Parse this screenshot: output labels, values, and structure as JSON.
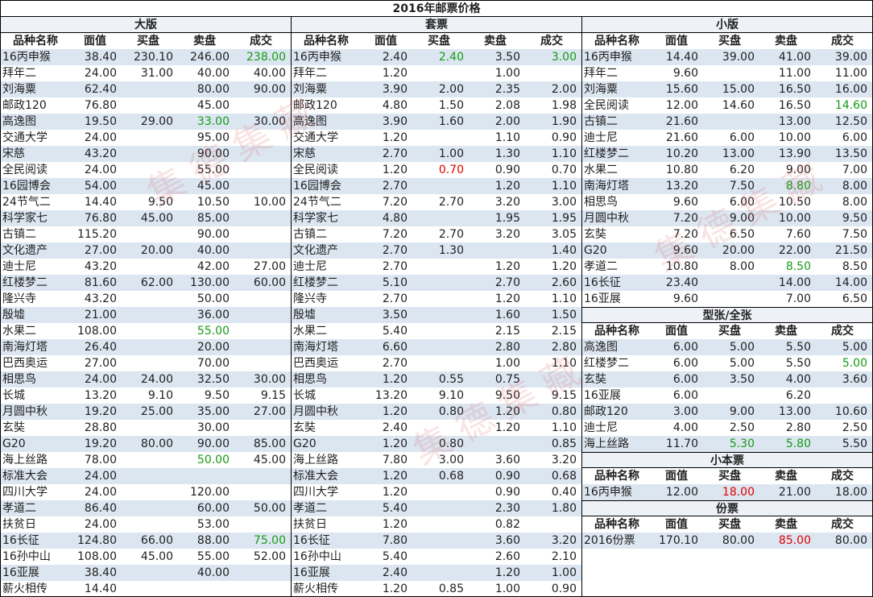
{
  "title": "2016年邮票价格",
  "headers": [
    "品种名称",
    "面值",
    "买盘",
    "卖盘",
    "成交"
  ],
  "watermark": "集德集藏",
  "large": {
    "heading": "大版",
    "rows": [
      {
        "name": "16丙申猴",
        "face": "38.40",
        "buy": "230.10",
        "sell": "246.00",
        "deal": "238.00",
        "dealColor": "green"
      },
      {
        "name": "拜年二",
        "face": "24.00",
        "buy": "31.00",
        "sell": "40.00",
        "deal": "40.00"
      },
      {
        "name": "刘海粟",
        "face": "62.40",
        "buy": "",
        "sell": "80.00",
        "deal": "90.00"
      },
      {
        "name": "邮政120",
        "face": "76.80",
        "buy": "",
        "sell": "45.00",
        "deal": ""
      },
      {
        "name": "高逸图",
        "face": "19.50",
        "buy": "29.00",
        "sell": "33.00",
        "deal": "30.00",
        "sellColor": "green"
      },
      {
        "name": "交通大学",
        "face": "24.00",
        "buy": "",
        "sell": "95.00",
        "deal": ""
      },
      {
        "name": "宋慈",
        "face": "43.20",
        "buy": "",
        "sell": "90.00",
        "deal": ""
      },
      {
        "name": "全民阅读",
        "face": "24.00",
        "buy": "",
        "sell": "55.00",
        "deal": ""
      },
      {
        "name": "16园博会",
        "face": "54.00",
        "buy": "",
        "sell": "45.00",
        "deal": ""
      },
      {
        "name": "24节气二",
        "face": "14.40",
        "buy": "9.50",
        "sell": "10.50",
        "deal": "10.00"
      },
      {
        "name": "科学家七",
        "face": "76.80",
        "buy": "45.00",
        "sell": "85.00",
        "deal": ""
      },
      {
        "name": "古镇二",
        "face": "115.20",
        "buy": "",
        "sell": "90.00",
        "deal": ""
      },
      {
        "name": "文化遗产",
        "face": "27.00",
        "buy": "20.00",
        "sell": "40.00",
        "deal": ""
      },
      {
        "name": "迪士尼",
        "face": "43.20",
        "buy": "",
        "sell": "42.00",
        "deal": "27.00"
      },
      {
        "name": "红楼梦二",
        "face": "81.60",
        "buy": "62.00",
        "sell": "130.00",
        "deal": "60.00"
      },
      {
        "name": "隆兴寺",
        "face": "43.20",
        "buy": "",
        "sell": "50.00",
        "deal": ""
      },
      {
        "name": "殷墟",
        "face": "21.00",
        "buy": "",
        "sell": "36.00",
        "deal": ""
      },
      {
        "name": "水果二",
        "face": "108.00",
        "buy": "",
        "sell": "55.00",
        "deal": "",
        "sellColor": "green"
      },
      {
        "name": "南海灯塔",
        "face": "26.40",
        "buy": "",
        "sell": "20.00",
        "deal": ""
      },
      {
        "name": "巴西奥运",
        "face": "27.00",
        "buy": "",
        "sell": "70.00",
        "deal": ""
      },
      {
        "name": "相思鸟",
        "face": "24.00",
        "buy": "24.00",
        "sell": "32.50",
        "deal": "30.00"
      },
      {
        "name": "长城",
        "face": "13.20",
        "buy": "9.10",
        "sell": "9.50",
        "deal": "9.15"
      },
      {
        "name": "月圆中秋",
        "face": "19.20",
        "buy": "25.00",
        "sell": "35.00",
        "deal": "27.00"
      },
      {
        "name": "玄奘",
        "face": "28.80",
        "buy": "",
        "sell": "30.00",
        "deal": ""
      },
      {
        "name": "G20",
        "face": "19.20",
        "buy": "80.00",
        "sell": "90.00",
        "deal": "85.00"
      },
      {
        "name": "海上丝路",
        "face": "78.00",
        "buy": "",
        "sell": "50.00",
        "deal": "45.00",
        "sellColor": "green"
      },
      {
        "name": "标准大会",
        "face": "24.00",
        "buy": "",
        "sell": "",
        "deal": ""
      },
      {
        "name": "四川大学",
        "face": "24.00",
        "buy": "",
        "sell": "120.00",
        "deal": ""
      },
      {
        "name": "孝道二",
        "face": "86.40",
        "buy": "",
        "sell": "60.00",
        "deal": "50.00"
      },
      {
        "name": "扶贫日",
        "face": "24.00",
        "buy": "",
        "sell": "53.00",
        "deal": ""
      },
      {
        "name": "16长征",
        "face": "124.80",
        "buy": "66.00",
        "sell": "88.00",
        "deal": "75.00",
        "dealColor": "green"
      },
      {
        "name": "16孙中山",
        "face": "108.00",
        "buy": "45.00",
        "sell": "55.00",
        "deal": "52.00"
      },
      {
        "name": "16亚展",
        "face": "38.40",
        "buy": "",
        "sell": "40.00",
        "deal": ""
      },
      {
        "name": "薪火相传",
        "face": "14.40",
        "buy": "",
        "sell": "",
        "deal": ""
      }
    ]
  },
  "sets": {
    "heading": "套票",
    "rows": [
      {
        "name": "16丙申猴",
        "face": "2.40",
        "buy": "2.40",
        "sell": "3.50",
        "deal": "3.00",
        "buyColor": "green",
        "dealColor": "green"
      },
      {
        "name": "拜年二",
        "face": "1.20",
        "buy": "",
        "sell": "1.00",
        "deal": ""
      },
      {
        "name": "刘海粟",
        "face": "3.90",
        "buy": "2.00",
        "sell": "2.35",
        "deal": "2.00"
      },
      {
        "name": "邮政120",
        "face": "4.80",
        "buy": "1.50",
        "sell": "2.08",
        "deal": "1.98"
      },
      {
        "name": "高逸图",
        "face": "3.90",
        "buy": "1.60",
        "sell": "2.00",
        "deal": "1.90"
      },
      {
        "name": "交通大学",
        "face": "1.20",
        "buy": "",
        "sell": "1.10",
        "deal": "0.90"
      },
      {
        "name": "宋慈",
        "face": "2.70",
        "buy": "1.00",
        "sell": "1.30",
        "deal": "1.10"
      },
      {
        "name": "全民阅读",
        "face": "1.20",
        "buy": "0.70",
        "sell": "0.90",
        "deal": "0.70",
        "buyColor": "red"
      },
      {
        "name": "16园博会",
        "face": "2.70",
        "buy": "",
        "sell": "1.20",
        "deal": "1.10"
      },
      {
        "name": "24节气二",
        "face": "7.20",
        "buy": "2.70",
        "sell": "3.20",
        "deal": "3.00"
      },
      {
        "name": "科学家七",
        "face": "4.80",
        "buy": "",
        "sell": "1.95",
        "deal": "1.95"
      },
      {
        "name": "古镇二",
        "face": "7.20",
        "buy": "2.70",
        "sell": "3.20",
        "deal": "3.05"
      },
      {
        "name": "文化遗产",
        "face": "2.70",
        "buy": "1.30",
        "sell": "",
        "deal": "1.40"
      },
      {
        "name": "迪士尼",
        "face": "2.70",
        "buy": "",
        "sell": "1.20",
        "deal": "1.20"
      },
      {
        "name": "红楼梦二",
        "face": "5.10",
        "buy": "",
        "sell": "2.70",
        "deal": "2.60"
      },
      {
        "name": "隆兴寺",
        "face": "2.70",
        "buy": "",
        "sell": "1.20",
        "deal": "1.10"
      },
      {
        "name": "殷墟",
        "face": "3.50",
        "buy": "",
        "sell": "1.60",
        "deal": "1.50"
      },
      {
        "name": "水果二",
        "face": "5.40",
        "buy": "",
        "sell": "2.15",
        "deal": "2.15"
      },
      {
        "name": "南海灯塔",
        "face": "6.60",
        "buy": "",
        "sell": "2.80",
        "deal": "2.80"
      },
      {
        "name": "巴西奥运",
        "face": "2.70",
        "buy": "",
        "sell": "1.00",
        "deal": "1.10"
      },
      {
        "name": "相思鸟",
        "face": "1.20",
        "buy": "0.55",
        "sell": "0.75",
        "deal": ""
      },
      {
        "name": "长城",
        "face": "13.20",
        "buy": "9.10",
        "sell": "9.50",
        "deal": "9.15"
      },
      {
        "name": "月圆中秋",
        "face": "1.20",
        "buy": "0.80",
        "sell": "1.20",
        "deal": "0.80"
      },
      {
        "name": "玄奘",
        "face": "2.40",
        "buy": "",
        "sell": "1.20",
        "deal": "1.10"
      },
      {
        "name": "G20",
        "face": "1.20",
        "buy": "0.80",
        "sell": "",
        "deal": "0.85"
      },
      {
        "name": "海上丝路",
        "face": "7.80",
        "buy": "3.00",
        "sell": "3.60",
        "deal": "3.20"
      },
      {
        "name": "标准大会",
        "face": "1.20",
        "buy": "0.68",
        "sell": "0.90",
        "deal": "0.68"
      },
      {
        "name": "四川大学",
        "face": "1.20",
        "buy": "",
        "sell": "0.90",
        "deal": "0.40"
      },
      {
        "name": "孝道二",
        "face": "5.40",
        "buy": "",
        "sell": "2.30",
        "deal": "1.80"
      },
      {
        "name": "扶贫日",
        "face": "1.20",
        "buy": "",
        "sell": "0.82",
        "deal": ""
      },
      {
        "name": "16长征",
        "face": "7.80",
        "buy": "",
        "sell": "3.60",
        "deal": "3.20"
      },
      {
        "name": "16孙中山",
        "face": "5.40",
        "buy": "",
        "sell": "2.60",
        "deal": "2.10"
      },
      {
        "name": "16亚展",
        "face": "2.40",
        "buy": "",
        "sell": "1.20",
        "deal": "1.00"
      },
      {
        "name": "薪火相传",
        "face": "1.20",
        "buy": "0.85",
        "sell": "1.00",
        "deal": "0.90"
      }
    ]
  },
  "small": {
    "heading": "小版",
    "rows": [
      {
        "name": "16丙申猴",
        "face": "14.40",
        "buy": "39.00",
        "sell": "41.00",
        "deal": "39.00"
      },
      {
        "name": "拜年二",
        "face": "9.60",
        "buy": "",
        "sell": "11.00",
        "deal": "11.00"
      },
      {
        "name": "刘海粟",
        "face": "15.60",
        "buy": "15.00",
        "sell": "16.50",
        "deal": "16.00"
      },
      {
        "name": "全民阅读",
        "face": "12.00",
        "buy": "14.60",
        "sell": "16.50",
        "deal": "14.60",
        "dealColor": "green"
      },
      {
        "name": "古镇二",
        "face": "21.60",
        "buy": "",
        "sell": "13.00",
        "deal": "12.50"
      },
      {
        "name": "迪士尼",
        "face": "21.60",
        "buy": "6.00",
        "sell": "10.00",
        "deal": "6.00"
      },
      {
        "name": "红楼梦二",
        "face": "10.20",
        "buy": "13.00",
        "sell": "13.90",
        "deal": "13.50"
      },
      {
        "name": "水果二",
        "face": "10.80",
        "buy": "6.20",
        "sell": "9.00",
        "deal": "7.00"
      },
      {
        "name": "南海灯塔",
        "face": "13.20",
        "buy": "7.50",
        "sell": "8.80",
        "deal": "8.00",
        "sellColor": "green"
      },
      {
        "name": "相思鸟",
        "face": "9.60",
        "buy": "6.00",
        "sell": "10.50",
        "deal": "8.00"
      },
      {
        "name": "月圆中秋",
        "face": "7.20",
        "buy": "9.00",
        "sell": "10.00",
        "deal": "9.50"
      },
      {
        "name": "玄奘",
        "face": "7.20",
        "buy": "6.50",
        "sell": "7.60",
        "deal": "7.50"
      },
      {
        "name": "G20",
        "face": "9.60",
        "buy": "20.00",
        "sell": "22.00",
        "deal": "21.50"
      },
      {
        "name": "孝道二",
        "face": "10.80",
        "buy": "8.00",
        "sell": "8.50",
        "deal": "8.50",
        "sellColor": "green"
      },
      {
        "name": "16长征",
        "face": "23.40",
        "buy": "",
        "sell": "14.00",
        "deal": "14.00"
      },
      {
        "name": "16亚展",
        "face": "9.60",
        "buy": "",
        "sell": "7.00",
        "deal": "6.50"
      }
    ]
  },
  "full_sheet": {
    "heading": "型张/全张",
    "rows": [
      {
        "name": "高逸图",
        "face": "6.00",
        "buy": "5.00",
        "sell": "5.50",
        "deal": "5.00"
      },
      {
        "name": "红楼梦二",
        "face": "6.00",
        "buy": "5.00",
        "sell": "5.50",
        "deal": "5.00",
        "dealColor": "green"
      },
      {
        "name": "玄奘",
        "face": "6.00",
        "buy": "3.50",
        "sell": "4.00",
        "deal": "3.60"
      },
      {
        "name": "16亚展",
        "face": "6.00",
        "buy": "",
        "sell": "6.20",
        "deal": ""
      },
      {
        "name": "邮政120",
        "face": "3.00",
        "buy": "9.00",
        "sell": "13.00",
        "deal": "10.60"
      },
      {
        "name": "迪士尼",
        "face": "4.00",
        "buy": "2.50",
        "sell": "2.80",
        "deal": "2.50"
      },
      {
        "name": "海上丝路",
        "face": "11.70",
        "buy": "5.30",
        "sell": "5.80",
        "deal": "5.50",
        "buyColor": "green",
        "sellColor": "green"
      }
    ]
  },
  "booklet": {
    "heading": "小本票",
    "rows": [
      {
        "name": "16丙申猴",
        "face": "12.00",
        "buy": "18.00",
        "sell": "21.00",
        "deal": "18.00",
        "buyColor": "red"
      }
    ]
  },
  "yearset": {
    "heading": "份票",
    "rows": [
      {
        "name": "2016份票",
        "face": "170.10",
        "buy": "80.00",
        "sell": "85.00",
        "deal": "80.00",
        "sellColor": "red"
      }
    ]
  }
}
